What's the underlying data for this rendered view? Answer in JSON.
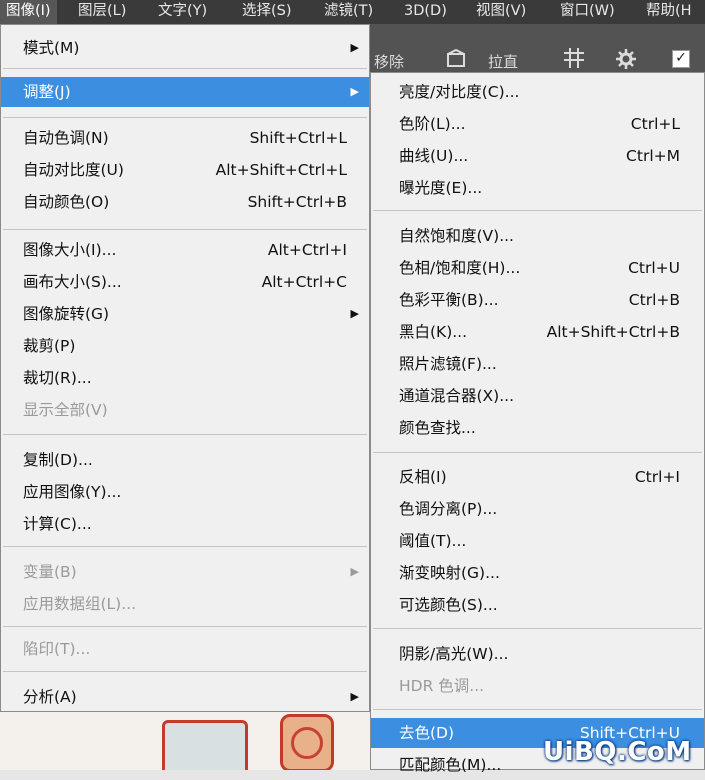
{
  "menubar": {
    "items": [
      "图像(I)",
      "图层(L)",
      "文字(Y)",
      "选择(S)",
      "滤镜(T)",
      "3D(D)",
      "视图(V)",
      "窗口(W)",
      "帮助(H"
    ]
  },
  "option_bar": {
    "partial_text": "移除",
    "pull_label": "拉直",
    "grid_icon": "grid-icon",
    "gear_icon": "gear-icon",
    "level_icon": "level-icon"
  },
  "image_menu": {
    "mode": {
      "label": "模式(M)"
    },
    "adjust": {
      "label": "调整(J)"
    },
    "auto_tone": {
      "label": "自动色调(N)",
      "shortcut": "Shift+Ctrl+L"
    },
    "auto_contrast": {
      "label": "自动对比度(U)",
      "shortcut": "Alt+Shift+Ctrl+L"
    },
    "auto_color": {
      "label": "自动颜色(O)",
      "shortcut": "Shift+Ctrl+B"
    },
    "image_size": {
      "label": "图像大小(I)...",
      "shortcut": "Alt+Ctrl+I"
    },
    "canvas_size": {
      "label": "画布大小(S)...",
      "shortcut": "Alt+Ctrl+C"
    },
    "image_rotation": {
      "label": "图像旋转(G)"
    },
    "crop": {
      "label": "裁剪(P)"
    },
    "trim": {
      "label": "裁切(R)..."
    },
    "reveal_all": {
      "label": "显示全部(V)"
    },
    "duplicate": {
      "label": "复制(D)..."
    },
    "apply_image": {
      "label": "应用图像(Y)..."
    },
    "calculations": {
      "label": "计算(C)..."
    },
    "variables": {
      "label": "变量(B)"
    },
    "apply_data_set": {
      "label": "应用数据组(L)..."
    },
    "trap": {
      "label": "陷印(T)..."
    },
    "analysis": {
      "label": "分析(A)"
    }
  },
  "adjust_menu": {
    "brightness_contrast": {
      "label": "亮度/对比度(C)..."
    },
    "levels": {
      "label": "色阶(L)...",
      "shortcut": "Ctrl+L"
    },
    "curves": {
      "label": "曲线(U)...",
      "shortcut": "Ctrl+M"
    },
    "exposure": {
      "label": "曝光度(E)..."
    },
    "vibrance": {
      "label": "自然饱和度(V)..."
    },
    "hue_saturation": {
      "label": "色相/饱和度(H)...",
      "shortcut": "Ctrl+U"
    },
    "color_balance": {
      "label": "色彩平衡(B)...",
      "shortcut": "Ctrl+B"
    },
    "black_white": {
      "label": "黑白(K)...",
      "shortcut": "Alt+Shift+Ctrl+B"
    },
    "photo_filter": {
      "label": "照片滤镜(F)..."
    },
    "channel_mixer": {
      "label": "通道混合器(X)..."
    },
    "color_lookup": {
      "label": "颜色查找..."
    },
    "invert": {
      "label": "反相(I)",
      "shortcut": "Ctrl+I"
    },
    "posterize": {
      "label": "色调分离(P)..."
    },
    "threshold": {
      "label": "阈值(T)..."
    },
    "gradient_map": {
      "label": "渐变映射(G)..."
    },
    "selective_color": {
      "label": "可选颜色(S)..."
    },
    "shadows_highlights": {
      "label": "阴影/高光(W)..."
    },
    "hdr_toning": {
      "label": "HDR 色调..."
    },
    "desaturate": {
      "label": "去色(D)",
      "shortcut": "Shift+Ctrl+U"
    },
    "match_color": {
      "label": "匹配颜色(M)..."
    }
  },
  "watermark": "UiBQ.CoM",
  "colors": {
    "highlight": "#3c8fe0",
    "menubar": "#3a3a3a",
    "menu_bg": "#f0f0f0",
    "disabled": "#9a9a9a"
  }
}
